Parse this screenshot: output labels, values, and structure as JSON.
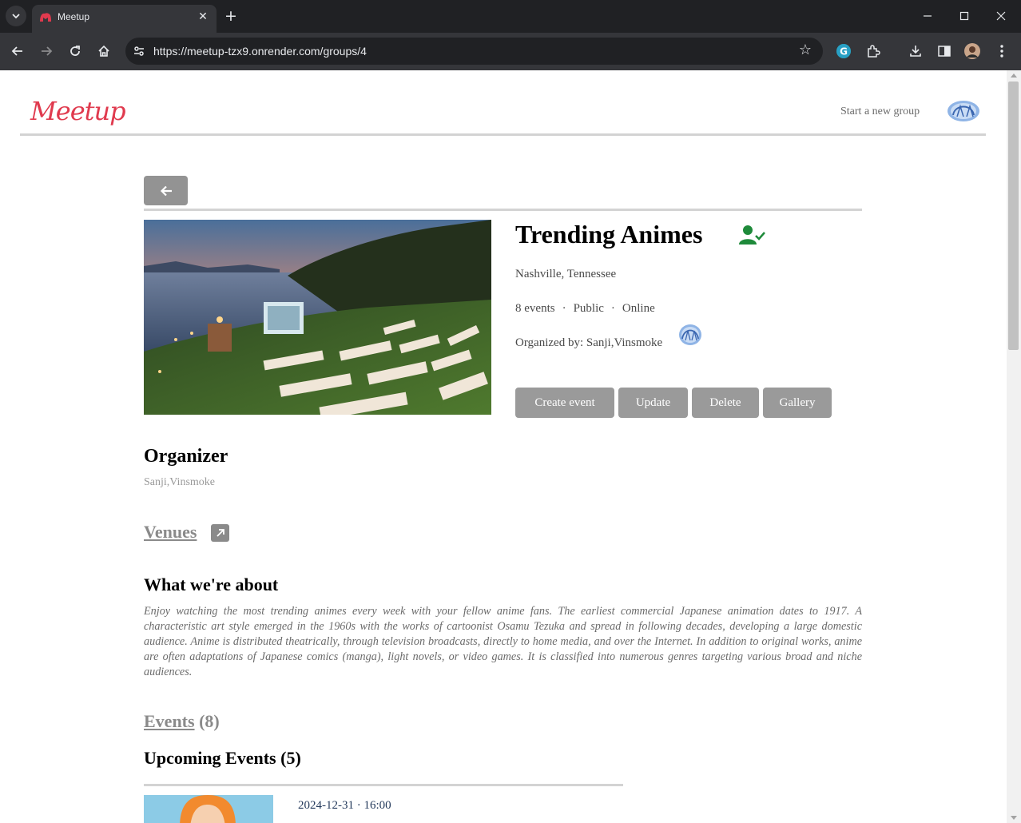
{
  "browser": {
    "tab_title": "Meetup",
    "url": "https://meetup-tzx9.onrender.com/groups/4"
  },
  "header": {
    "logo_text": "Meetup",
    "start_group": "Start a new group"
  },
  "group": {
    "title": "Trending Animes",
    "location": "Nashville, Tennessee",
    "events_count": "8 events",
    "privacy": "Public",
    "type": "Online",
    "separator": "·",
    "organized_by": "Organized by: Sanji,Vinsmoke",
    "actions": {
      "create_event": "Create event",
      "update": "Update",
      "delete": "Delete",
      "gallery": "Gallery"
    }
  },
  "organizer": {
    "title": "Organizer",
    "name": "Sanji,Vinsmoke"
  },
  "venues": {
    "label": "Venues"
  },
  "about": {
    "title": "What we're about",
    "text": "Enjoy watching the most trending animes every week with your fellow anime fans. The earliest commercial Japanese animation dates to 1917. A characteristic art style emerged in the 1960s with the works of cartoonist Osamu Tezuka and spread in following decades, developing a large domestic audience. Anime is distributed theatrically, through television broadcasts, directly to home media, and over the Internet. In addition to original works, anime are often adaptations of Japanese comics (manga), light novels, or video games. It is classified into numerous genres targeting various broad and niche audiences."
  },
  "events": {
    "label": "Events",
    "count": "(8)",
    "upcoming_title": "Upcoming Events (5)",
    "items": [
      {
        "datetime": "2024-12-31 · 16:00"
      }
    ]
  },
  "colors": {
    "brand": "#e03a4e",
    "button_gray": "#9a9a9a",
    "member_green": "#1e8a3a"
  }
}
